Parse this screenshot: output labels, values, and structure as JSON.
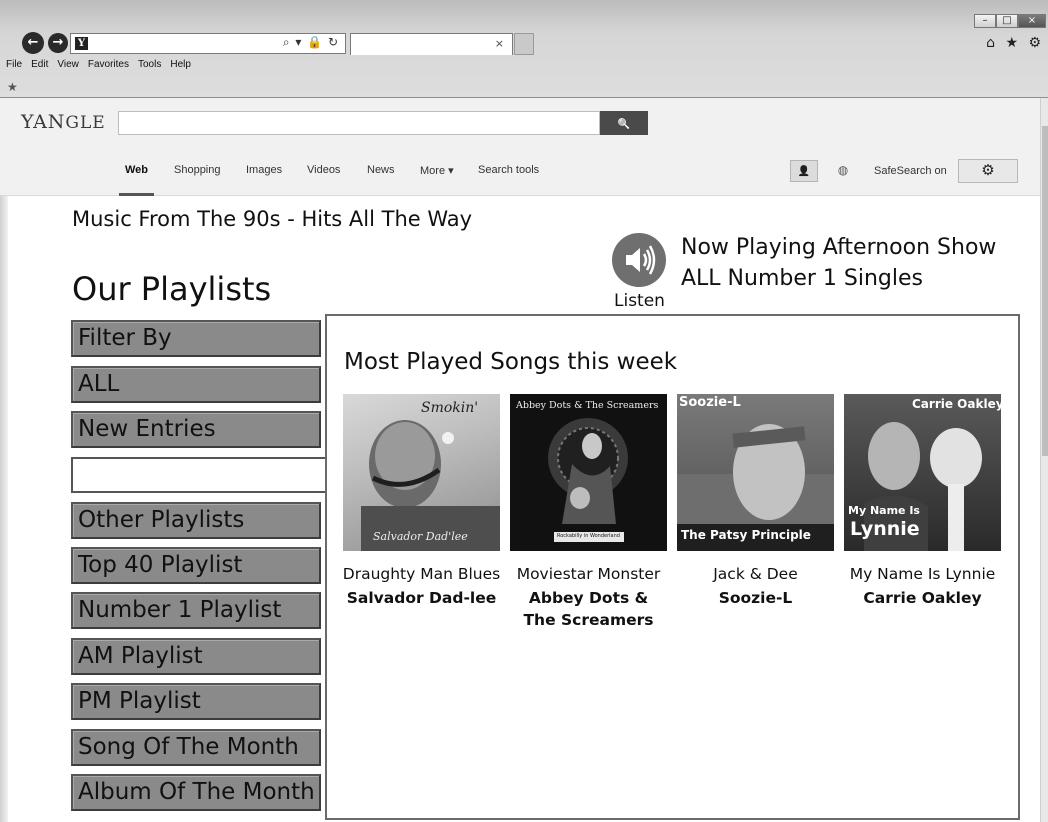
{
  "browser": {
    "back_glyph": "←",
    "forward_glyph": "→",
    "favicon_letter": "Y",
    "address_tools": "⌕ ▾ 🔒 ↻",
    "tab_close": "×",
    "window_controls": {
      "minimize": "–",
      "maximize": "□",
      "close": "×"
    },
    "right_icons": "⌂ ★ ⚙",
    "menu": [
      "File",
      "Edit",
      "View",
      "Favorites",
      "Tools",
      "Help"
    ],
    "favorites_star": "★"
  },
  "search": {
    "logo_prefix": "YAN",
    "logo_suffix": "GLE",
    "input_value": "",
    "button_glyph": "🔍",
    "tabs": [
      {
        "label": "Web",
        "active": true
      },
      {
        "label": "Shopping"
      },
      {
        "label": "Images"
      },
      {
        "label": "Videos"
      },
      {
        "label": "News"
      },
      {
        "label": "More ▾"
      },
      {
        "label": "Search tools"
      }
    ],
    "person_glyph": "👤",
    "globe_glyph": "◍",
    "safesearch_label": "SafeSearch on",
    "settings_glyph": "⚙"
  },
  "page": {
    "heading": "Music From The 90s - Hits All The Way",
    "now_playing_line1": "Now Playing Afternoon Show",
    "now_playing_line2": "ALL Number 1 Singles",
    "listen_label": "Listen",
    "playlists_title": "Our Playlists"
  },
  "sidebar": {
    "items": [
      "Filter By",
      "ALL",
      "New Entries",
      "Other Playlists",
      "Top 40 Playlist",
      "Number 1 Playlist",
      "AM Playlist",
      "PM Playlist",
      "Song Of The Month",
      "Album Of The Month"
    ],
    "blank_field_value": ""
  },
  "main": {
    "title": "Most Played Songs this week",
    "albums": [
      {
        "song": "Draughty Man Blues",
        "artist": "Salvador Dad-lee",
        "cover_top": "Smokin'",
        "cover_bottom": "Salvador Dad'lee"
      },
      {
        "song": "Moviestar Monster",
        "artist": "Abbey Dots & The Screamers",
        "artist_line1": "Abbey Dots &",
        "artist_line2": "The Screamers",
        "cover_top": "Abbey Dots & The Screamers",
        "cover_bottom": "Rockabilly in Wonderland"
      },
      {
        "song": "Jack & Dee",
        "artist": "Soozie-L",
        "cover_top": "Soozie-L",
        "cover_bottom": "The Patsy Principle"
      },
      {
        "song": "My Name Is Lynnie",
        "artist": "Carrie Oakley",
        "cover_top": "Carrie Oakley",
        "cover_bottom_line1": "My Name Is",
        "cover_bottom_line2": "Lynnie"
      }
    ]
  }
}
